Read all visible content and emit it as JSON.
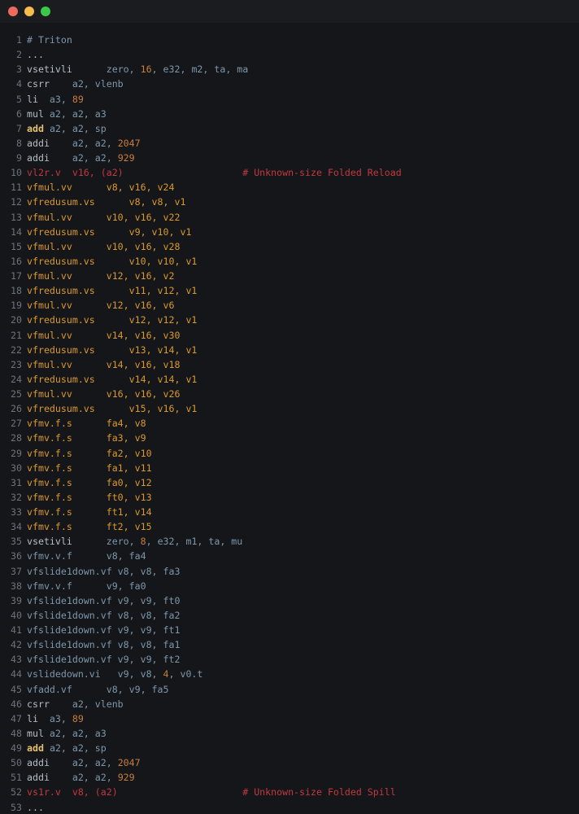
{
  "window": {
    "controls": [
      {
        "name": "close-button",
        "color": "#ee6a5f"
      },
      {
        "name": "minimize-button",
        "color": "#f5bd4c"
      },
      {
        "name": "zoom-button",
        "color": "#3bc848"
      }
    ]
  },
  "colors": {
    "background": "#151619",
    "titlebar": "#1b1c20",
    "line_number": "#6d737d",
    "mnemonic_gray": "#b7bec7",
    "operand_blue": "#7e97ac",
    "immediate_orange": "#c87e3e",
    "vector_amber": "#d9992e",
    "add_gold": "#e3c171",
    "spill_red": "#c23940"
  },
  "code": {
    "lines": [
      {
        "num": 1,
        "tokens": [
          [
            "# Triton",
            "blue"
          ]
        ]
      },
      {
        "num": 2,
        "tokens": [
          [
            "...",
            "gray"
          ]
        ]
      },
      {
        "num": 3,
        "tokens": [
          [
            "vsetivli      ",
            "gray"
          ],
          [
            "zero, ",
            "blue"
          ],
          [
            "16",
            "orange"
          ],
          [
            ", e32, m2, ta, ma",
            "blue"
          ]
        ]
      },
      {
        "num": 4,
        "tokens": [
          [
            "csrr    ",
            "gray"
          ],
          [
            "a2, vlenb",
            "blue"
          ]
        ]
      },
      {
        "num": 5,
        "tokens": [
          [
            "li  ",
            "gray"
          ],
          [
            "a3, ",
            "blue"
          ],
          [
            "89",
            "orange"
          ]
        ]
      },
      {
        "num": 6,
        "tokens": [
          [
            "mul ",
            "gray"
          ],
          [
            "a2, a2, a3",
            "blue"
          ]
        ]
      },
      {
        "num": 7,
        "tokens": [
          [
            "add",
            "gold"
          ],
          [
            " ",
            "gray"
          ],
          [
            "a2, a2, sp",
            "blue"
          ]
        ]
      },
      {
        "num": 8,
        "tokens": [
          [
            "addi    ",
            "gray"
          ],
          [
            "a2, a2, ",
            "blue"
          ],
          [
            "2047",
            "orange"
          ]
        ]
      },
      {
        "num": 9,
        "tokens": [
          [
            "addi    ",
            "gray"
          ],
          [
            "a2, a2, ",
            "blue"
          ],
          [
            "929",
            "orange"
          ]
        ]
      },
      {
        "num": 10,
        "tokens": [
          [
            "vl2r.v  v16, (a2)                     # Unknown-size Folded Reload",
            "red"
          ]
        ]
      },
      {
        "num": 11,
        "tokens": [
          [
            "vfmul.vv      v8, v16, v24",
            "amber"
          ]
        ]
      },
      {
        "num": 12,
        "tokens": [
          [
            "vfredusum.vs      v8, v8, v1",
            "amber"
          ]
        ]
      },
      {
        "num": 13,
        "tokens": [
          [
            "vfmul.vv      v10, v16, v22",
            "amber"
          ]
        ]
      },
      {
        "num": 14,
        "tokens": [
          [
            "vfredusum.vs      v9, v10, v1",
            "amber"
          ]
        ]
      },
      {
        "num": 15,
        "tokens": [
          [
            "vfmul.vv      v10, v16, v28",
            "amber"
          ]
        ]
      },
      {
        "num": 16,
        "tokens": [
          [
            "vfredusum.vs      v10, v10, v1",
            "amber"
          ]
        ]
      },
      {
        "num": 17,
        "tokens": [
          [
            "vfmul.vv      v12, v16, v2",
            "amber"
          ]
        ]
      },
      {
        "num": 18,
        "tokens": [
          [
            "vfredusum.vs      v11, v12, v1",
            "amber"
          ]
        ]
      },
      {
        "num": 19,
        "tokens": [
          [
            "vfmul.vv      v12, v16, v6",
            "amber"
          ]
        ]
      },
      {
        "num": 20,
        "tokens": [
          [
            "vfredusum.vs      v12, v12, v1",
            "amber"
          ]
        ]
      },
      {
        "num": 21,
        "tokens": [
          [
            "vfmul.vv      v14, v16, v30",
            "amber"
          ]
        ]
      },
      {
        "num": 22,
        "tokens": [
          [
            "vfredusum.vs      v13, v14, v1",
            "amber"
          ]
        ]
      },
      {
        "num": 23,
        "tokens": [
          [
            "vfmul.vv      v14, v16, v18",
            "amber"
          ]
        ]
      },
      {
        "num": 24,
        "tokens": [
          [
            "vfredusum.vs      v14, v14, v1",
            "amber"
          ]
        ]
      },
      {
        "num": 25,
        "tokens": [
          [
            "vfmul.vv      v16, v16, v26",
            "amber"
          ]
        ]
      },
      {
        "num": 26,
        "tokens": [
          [
            "vfredusum.vs      v15, v16, v1",
            "amber"
          ]
        ]
      },
      {
        "num": 27,
        "tokens": [
          [
            "vfmv.f.s      fa4, v8",
            "amber"
          ]
        ]
      },
      {
        "num": 28,
        "tokens": [
          [
            "vfmv.f.s      fa3, v9",
            "amber"
          ]
        ]
      },
      {
        "num": 29,
        "tokens": [
          [
            "vfmv.f.s      fa2, v10",
            "amber"
          ]
        ]
      },
      {
        "num": 30,
        "tokens": [
          [
            "vfmv.f.s      fa1, v11",
            "amber"
          ]
        ]
      },
      {
        "num": 31,
        "tokens": [
          [
            "vfmv.f.s      fa0, v12",
            "amber"
          ]
        ]
      },
      {
        "num": 32,
        "tokens": [
          [
            "vfmv.f.s      ft0, v13",
            "amber"
          ]
        ]
      },
      {
        "num": 33,
        "tokens": [
          [
            "vfmv.f.s      ft1, v14",
            "amber"
          ]
        ]
      },
      {
        "num": 34,
        "tokens": [
          [
            "vfmv.f.s      ft2, v15",
            "amber"
          ]
        ]
      },
      {
        "num": 35,
        "tokens": [
          [
            "vsetivli      ",
            "gray"
          ],
          [
            "zero, ",
            "blue"
          ],
          [
            "8",
            "orange"
          ],
          [
            ", e32, m1, ta, mu",
            "blue"
          ]
        ]
      },
      {
        "num": 36,
        "tokens": [
          [
            "vfmv.v.f      v8, fa4",
            "blue"
          ]
        ]
      },
      {
        "num": 37,
        "tokens": [
          [
            "vfslide1down.vf v8, v8, fa3",
            "blue"
          ]
        ]
      },
      {
        "num": 38,
        "tokens": [
          [
            "vfmv.v.f      v9, fa0",
            "blue"
          ]
        ]
      },
      {
        "num": 39,
        "tokens": [
          [
            "vfslide1down.vf v9, v9, ft0",
            "blue"
          ]
        ]
      },
      {
        "num": 40,
        "tokens": [
          [
            "vfslide1down.vf v8, v8, fa2",
            "blue"
          ]
        ]
      },
      {
        "num": 41,
        "tokens": [
          [
            "vfslide1down.vf v9, v9, ft1",
            "blue"
          ]
        ]
      },
      {
        "num": 42,
        "tokens": [
          [
            "vfslide1down.vf v8, v8, fa1",
            "blue"
          ]
        ]
      },
      {
        "num": 43,
        "tokens": [
          [
            "vfslide1down.vf v9, v9, ft2",
            "blue"
          ]
        ]
      },
      {
        "num": 44,
        "tokens": [
          [
            "vslidedown.vi   v9, v8, ",
            "blue"
          ],
          [
            "4",
            "orange"
          ],
          [
            ", v0.t",
            "blue"
          ]
        ]
      },
      {
        "num": 45,
        "tokens": [
          [
            "vfadd.vf      v8, v9, fa5",
            "blue"
          ]
        ]
      },
      {
        "num": 46,
        "tokens": [
          [
            "csrr    ",
            "gray"
          ],
          [
            "a2, vlenb",
            "blue"
          ]
        ]
      },
      {
        "num": 47,
        "tokens": [
          [
            "li  ",
            "gray"
          ],
          [
            "a3, ",
            "blue"
          ],
          [
            "89",
            "orange"
          ]
        ]
      },
      {
        "num": 48,
        "tokens": [
          [
            "mul ",
            "gray"
          ],
          [
            "a2, a2, a3",
            "blue"
          ]
        ]
      },
      {
        "num": 49,
        "tokens": [
          [
            "add",
            "gold"
          ],
          [
            " ",
            "gray"
          ],
          [
            "a2, a2, sp",
            "blue"
          ]
        ]
      },
      {
        "num": 50,
        "tokens": [
          [
            "addi    ",
            "gray"
          ],
          [
            "a2, a2, ",
            "blue"
          ],
          [
            "2047",
            "orange"
          ]
        ]
      },
      {
        "num": 51,
        "tokens": [
          [
            "addi    ",
            "gray"
          ],
          [
            "a2, a2, ",
            "blue"
          ],
          [
            "929",
            "orange"
          ]
        ]
      },
      {
        "num": 52,
        "tokens": [
          [
            "vs1r.v  v8, (a2)                      # Unknown-size Folded Spill",
            "red"
          ]
        ]
      },
      {
        "num": 53,
        "tokens": [
          [
            "...",
            "gray"
          ]
        ]
      }
    ]
  }
}
